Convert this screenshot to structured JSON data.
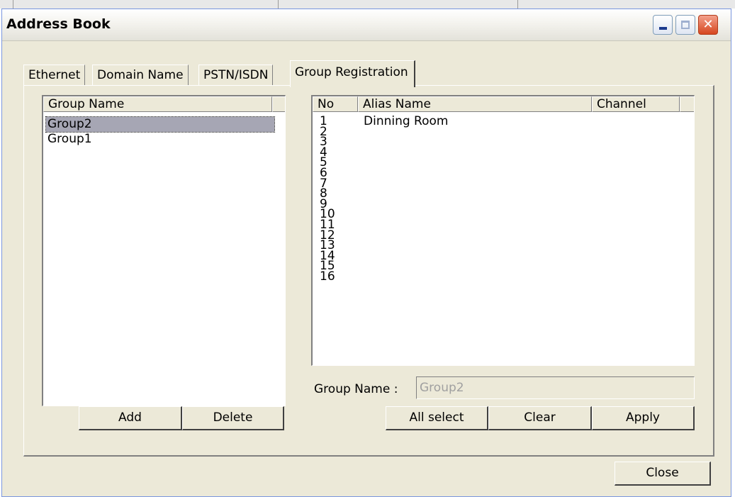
{
  "window": {
    "title": "Address Book",
    "close_glyph": "✕",
    "controls": {
      "minimize": "minimize-icon",
      "maximize": "maximize-icon",
      "close": "close-icon"
    }
  },
  "tabs": [
    "Ethernet",
    "Domain Name",
    "PSTN/ISDN",
    "Group Registration"
  ],
  "active_tab": "Group Registration",
  "groups": {
    "header": "Group Name",
    "items": [
      "Group2",
      "Group1"
    ],
    "selected": "Group2",
    "add_label": "Add",
    "delete_label": "Delete"
  },
  "members": {
    "columns": [
      "No",
      "Alias Name",
      "Channel"
    ],
    "rows": [
      {
        "no": "1",
        "alias": "Dinning Room"
      },
      {
        "no": "2",
        "alias": ""
      },
      {
        "no": "3",
        "alias": ""
      },
      {
        "no": "4",
        "alias": ""
      },
      {
        "no": "5",
        "alias": ""
      },
      {
        "no": "6",
        "alias": ""
      },
      {
        "no": "7",
        "alias": ""
      },
      {
        "no": "8",
        "alias": ""
      },
      {
        "no": "9",
        "alias": ""
      },
      {
        "no": "10",
        "alias": ""
      },
      {
        "no": "11",
        "alias": ""
      },
      {
        "no": "12",
        "alias": ""
      },
      {
        "no": "13",
        "alias": ""
      },
      {
        "no": "14",
        "alias": ""
      },
      {
        "no": "15",
        "alias": ""
      },
      {
        "no": "16",
        "alias": ""
      }
    ]
  },
  "group_name_field": {
    "label": "Group Name :",
    "value": "Group2"
  },
  "actions": {
    "all_select": "All select",
    "clear": "Clear",
    "apply": "Apply"
  },
  "footer": {
    "close_label": "Close"
  },
  "colors": {
    "face": "#ece9d8",
    "selection": "#a6a6b4",
    "close_button": "#d6461f",
    "disabled_text": "#a0a0a0"
  }
}
